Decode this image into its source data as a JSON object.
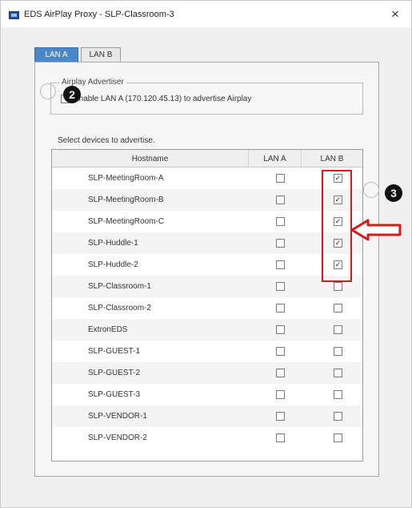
{
  "window": {
    "title": "EDS AirPlay Proxy - SLP-Classroom-3",
    "close_glyph": "×"
  },
  "tabs": [
    {
      "label": "LAN A",
      "active": true
    },
    {
      "label": "LAN B",
      "active": false
    }
  ],
  "advertiser": {
    "legend": "Airplay Advertiser",
    "checkbox_label": "Enable LAN A (170.120.45.13) to advertise Airplay",
    "checked": false
  },
  "select_label": "Select devices to advertise.",
  "table": {
    "columns": [
      "Hostname",
      "LAN A",
      "LAN B"
    ],
    "rows": [
      {
        "hostname": "SLP-MeetingRoom-A",
        "lan_a": false,
        "lan_b": true
      },
      {
        "hostname": "SLP-MeetingRoom-B",
        "lan_a": false,
        "lan_b": true
      },
      {
        "hostname": "SLP-MeetingRoom-C",
        "lan_a": false,
        "lan_b": true
      },
      {
        "hostname": "SLP-Huddle-1",
        "lan_a": false,
        "lan_b": true
      },
      {
        "hostname": "SLP-Huddle-2",
        "lan_a": false,
        "lan_b": true
      },
      {
        "hostname": "SLP-Classroom-1",
        "lan_a": false,
        "lan_b": false
      },
      {
        "hostname": "SLP-Classroom-2",
        "lan_a": false,
        "lan_b": false
      },
      {
        "hostname": "ExtronEDS",
        "lan_a": false,
        "lan_b": false
      },
      {
        "hostname": "SLP-GUEST-1",
        "lan_a": false,
        "lan_b": false
      },
      {
        "hostname": "SLP-GUEST-2",
        "lan_a": false,
        "lan_b": false
      },
      {
        "hostname": "SLP-GUEST-3",
        "lan_a": false,
        "lan_b": false
      },
      {
        "hostname": "SLP-VENDOR-1",
        "lan_a": false,
        "lan_b": false
      },
      {
        "hostname": "SLP-VENDOR-2",
        "lan_a": false,
        "lan_b": false
      }
    ]
  },
  "annotations": {
    "step_2": "2",
    "step_3": "3",
    "highlight_color": "#d41a1a",
    "arrow_icon": "left-arrow-icon"
  },
  "colors": {
    "active_tab": "#4a86c8",
    "check_glyph": "✓"
  }
}
